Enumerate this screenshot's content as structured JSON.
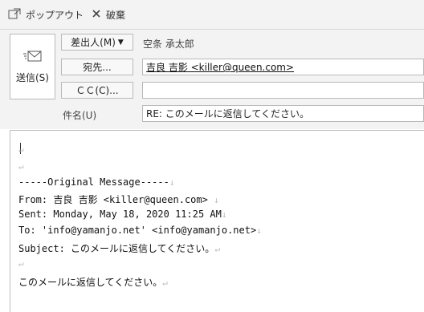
{
  "toolbar": {
    "popout_label": "ポップアウト",
    "discard_label": "破棄"
  },
  "header": {
    "send_label": "送信(S)",
    "from_button_label": "差出人(M)",
    "from_value": "空条 承太郎",
    "to_button_label": "宛先...",
    "to_value": "吉良 吉影 <killer@queen.com>",
    "cc_button_label": "ＣＣ(C)...",
    "cc_value": "",
    "subject_label": "件名(U)",
    "subject_value": "RE: このメールに返信してください。"
  },
  "body": {
    "return_mark": "↵",
    "down_mark": "↓",
    "original_line": "-----Original Message-----",
    "from_line": "From: 吉良 吉影 <killer@queen.com>",
    "sent_line": "Sent: Monday, May 18, 2020 11:25 AM",
    "to_line": "To: 'info@yamanjo.net' <info@yamanjo.net>",
    "subject_line": "Subject: このメールに返信してください。",
    "message_line": "このメールに返信してください。"
  }
}
